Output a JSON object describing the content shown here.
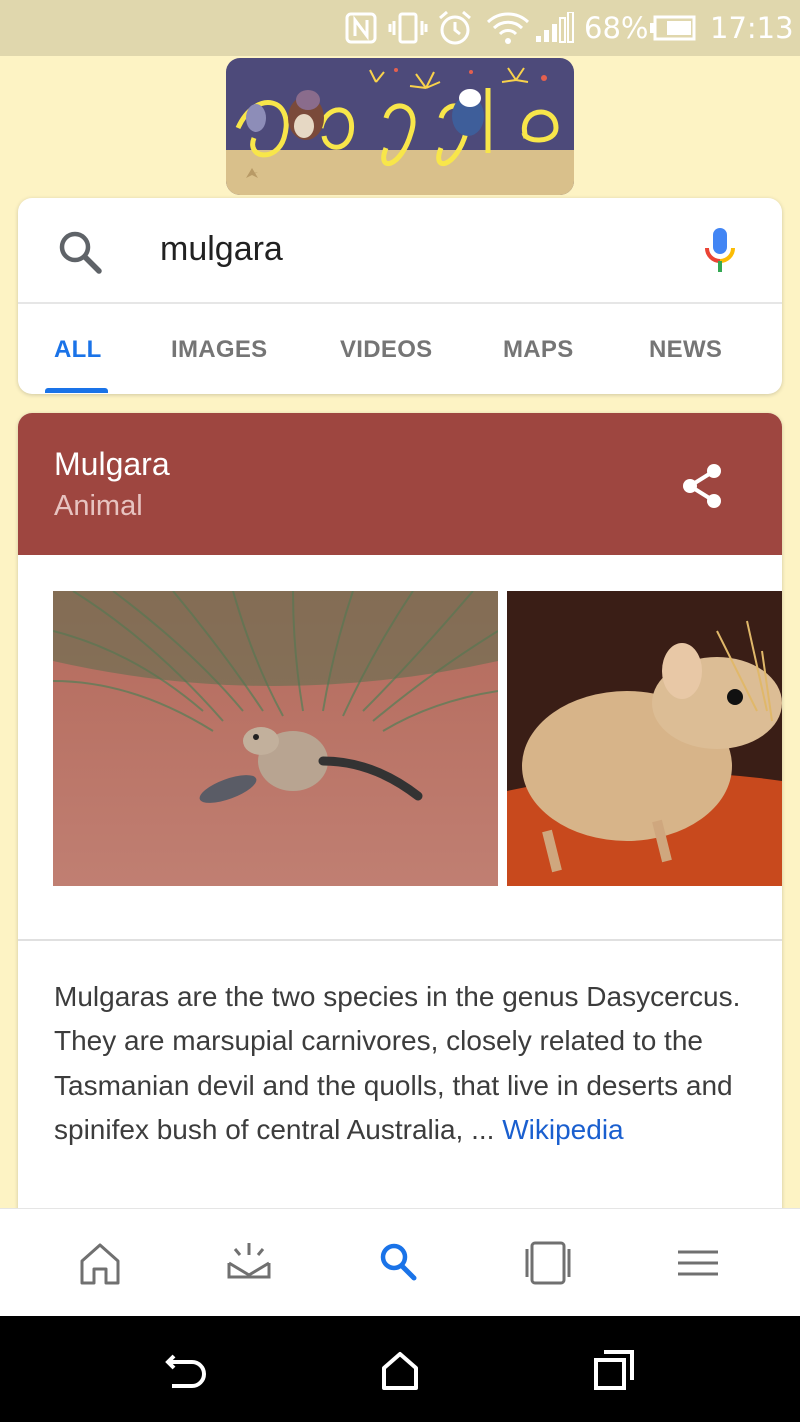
{
  "status_bar": {
    "battery": "68%",
    "time": "17:13"
  },
  "doodle": {
    "icon": "google-doodle-icon"
  },
  "search": {
    "query": "mulgara",
    "search_icon": "search-icon",
    "mic_icon": "microphone-icon"
  },
  "tabs": [
    {
      "label": "ALL",
      "active": true
    },
    {
      "label": "IMAGES",
      "active": false
    },
    {
      "label": "VIDEOS",
      "active": false
    },
    {
      "label": "MAPS",
      "active": false
    },
    {
      "label": "NEWS",
      "active": false
    }
  ],
  "knowledge_panel": {
    "title": "Mulgara",
    "subtitle": "Animal",
    "header_color": "#9e4640",
    "share_icon": "share-icon",
    "description": "Mulgaras are the two species in the genus Dasycercus. They are marsupial carnivores, closely related to the Tasmanian devil and the quolls, that live in deserts and spinifex bush of central Australia, ...",
    "source_link": "Wikipedia"
  },
  "bottom_nav": {
    "items": [
      "home-icon",
      "updates-icon",
      "search-icon",
      "recents-icon",
      "menu-icon"
    ],
    "active": "search-icon",
    "accent_color": "#1a73e8"
  },
  "system_nav": {
    "items": [
      "back-icon",
      "home-icon",
      "overview-icon"
    ]
  }
}
